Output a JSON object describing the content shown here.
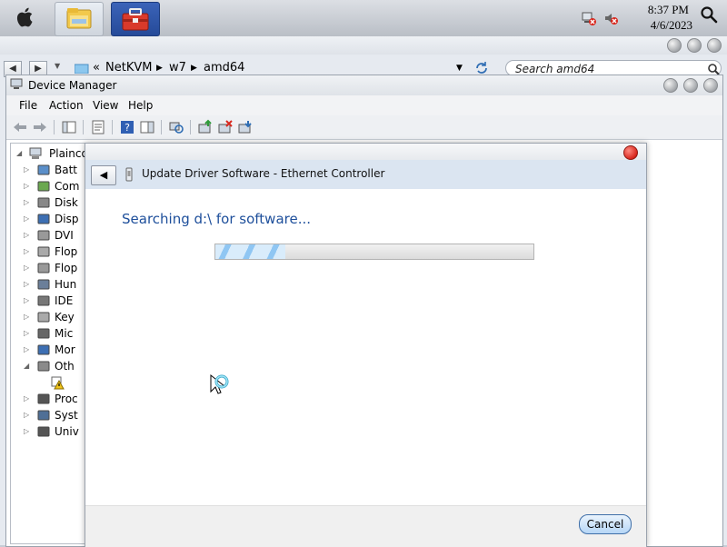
{
  "topbar": {
    "clock_time": "8:37 PM",
    "clock_date": "4/6/2023",
    "dock": [
      {
        "icon": "file-explorer-icon"
      },
      {
        "icon": "toolbox-icon"
      }
    ],
    "tray": [
      {
        "icon": "network-disconnected-icon"
      },
      {
        "icon": "speaker-muted-icon"
      }
    ]
  },
  "explorer": {
    "breadcrumb_prefix": "«",
    "crumbs": [
      "NetKVM",
      "w7",
      "amd64"
    ],
    "search_placeholder": "Search amd64"
  },
  "devmgr": {
    "title": "Device Manager",
    "menu": [
      "File",
      "Action",
      "View",
      "Help"
    ],
    "tree_root": "Plainco",
    "tree": [
      {
        "label": "Batt",
        "icon": "battery-icon"
      },
      {
        "label": "Com",
        "icon": "computer-icon"
      },
      {
        "label": "Disk",
        "icon": "disk-drive-icon"
      },
      {
        "label": "Disp",
        "icon": "display-icon"
      },
      {
        "label": "DVI",
        "icon": "dvd-icon"
      },
      {
        "label": "Flop",
        "icon": "floppy-disk-icon"
      },
      {
        "label": "Flop",
        "icon": "floppy-controller-icon"
      },
      {
        "label": "Hun",
        "icon": "hid-icon"
      },
      {
        "label": "IDE",
        "icon": "ide-controller-icon"
      },
      {
        "label": "Key",
        "icon": "keyboard-icon"
      },
      {
        "label": "Mic",
        "icon": "mouse-icon"
      },
      {
        "label": "Mor",
        "icon": "monitor-icon"
      },
      {
        "label": "Oth",
        "icon": "other-devices-icon"
      },
      {
        "label": "",
        "icon": "warning-device-icon"
      },
      {
        "label": "Proc",
        "icon": "processor-icon"
      },
      {
        "label": "Syst",
        "icon": "system-devices-icon"
      },
      {
        "label": "Univ",
        "icon": "usb-icon"
      }
    ]
  },
  "dialog": {
    "title": "Update Driver Software - Ethernet Controller",
    "heading": "Searching d:\\ for software...",
    "progress_fraction": 0.22,
    "cancel_label": "Cancel"
  },
  "colors": {
    "dialog_heading": "#1e4f9b",
    "dialog_header_bg": "#dbe5f1",
    "close_red": "#d8261c"
  }
}
